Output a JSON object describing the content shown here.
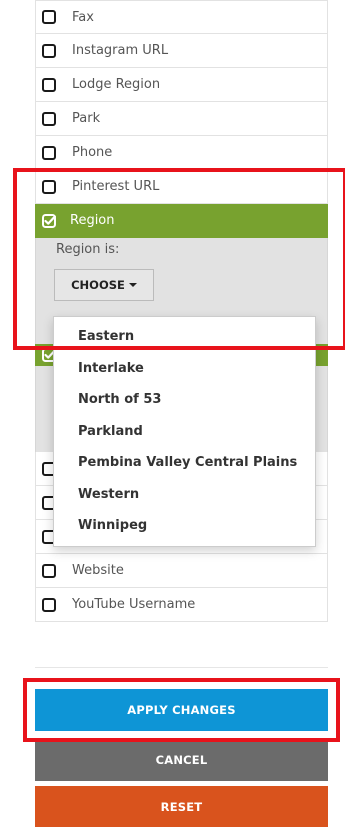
{
  "filters": {
    "top_items": [
      {
        "label": "Fax"
      },
      {
        "label": "Instagram URL"
      },
      {
        "label": "Lodge Region"
      },
      {
        "label": "Park"
      },
      {
        "label": "Phone"
      },
      {
        "label": "Pinterest URL"
      }
    ],
    "active": {
      "label": "Region",
      "panel_label": "Region is:",
      "choose_label": "CHOOSE"
    },
    "bottom_items": [
      {
        "label": "Website"
      },
      {
        "label": "YouTube Username"
      }
    ]
  },
  "dropdown": {
    "options": [
      "Eastern",
      "Interlake",
      "North of 53",
      "Parkland",
      "Pembina Valley Central Plains",
      "Western",
      "Winnipeg"
    ]
  },
  "actions": {
    "apply_label": "APPLY CHANGES",
    "cancel_label": "CANCEL",
    "reset_label": "RESET"
  },
  "colors": {
    "active_green": "#78a22f",
    "apply_blue": "#0e95d6",
    "cancel_gray": "#6b6b6b",
    "reset_orange": "#d9531d",
    "highlight_red": "#e8131b"
  }
}
